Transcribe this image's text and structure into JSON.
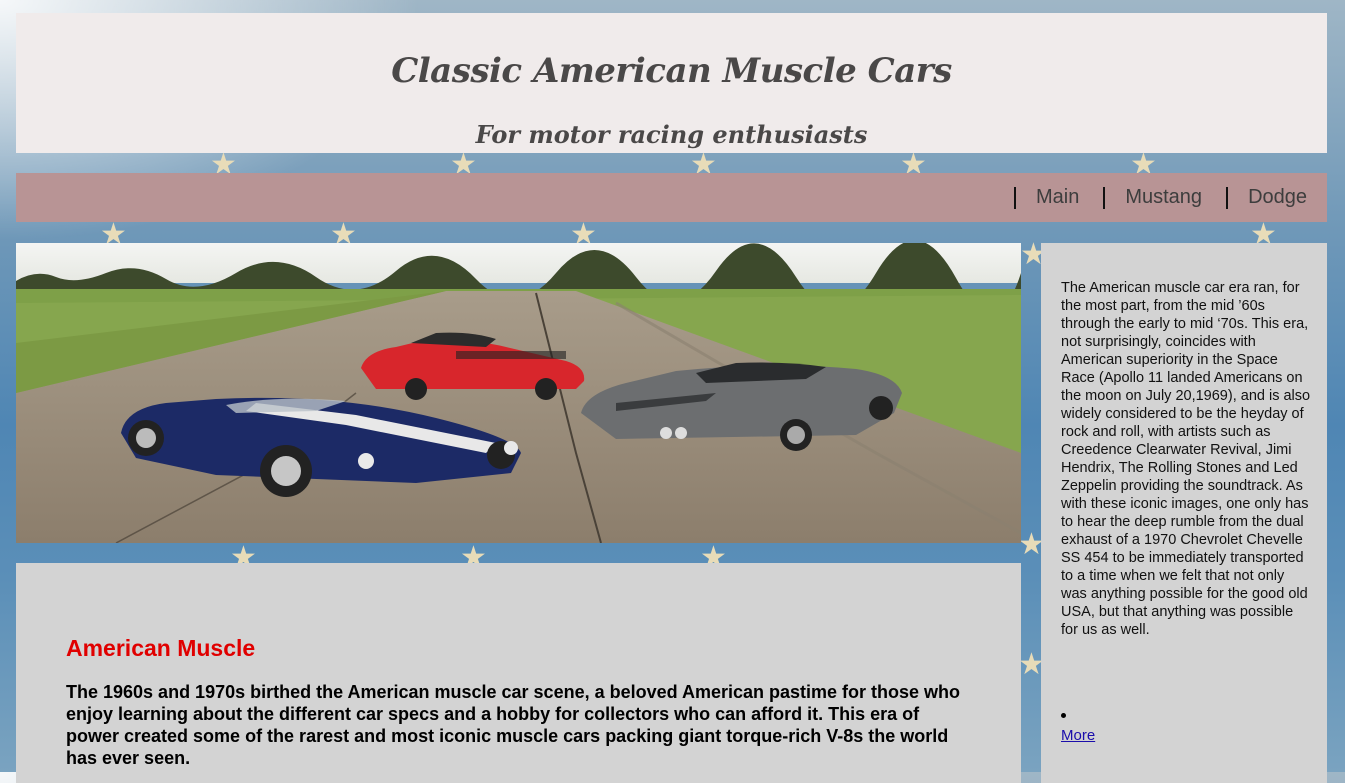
{
  "header": {
    "title": "Classic American Muscle Cars",
    "subtitle": "For motor racing enthusiasts"
  },
  "nav": {
    "items": [
      {
        "label": "Main"
      },
      {
        "label": "Mustang"
      },
      {
        "label": "Dodge"
      }
    ]
  },
  "hero": {
    "image": "three-classic-muscle-cars-on-runway"
  },
  "article": {
    "heading": "American Muscle",
    "body": "The 1960s and 1970s birthed the American muscle car scene, a beloved American pastime for those who enjoy learning about the different car specs and a hobby for collectors who can afford it. This era of power created some of the rarest and most iconic muscle cars packing giant torque-rich V-8s the world has ever seen."
  },
  "sidebar": {
    "text": "The American muscle car era ran, for the most part, from the mid ’60s through the early to mid ‘70s. This era, not surprisingly, coincides with American superiority in the Space Race (Apollo 11 landed Americans on the moon on July 20,1969), and is also widely considered to be the heyday of rock and roll, with artists such as Creedence Clearwater Revival, Jimi Hendrix, The Rolling Stones and Led Zeppelin providing the soundtrack. As with these iconic images, one only has to hear the deep rumble from the dual exhaust of a 1970 Chevrolet Chevelle SS 454 to be immediately transported to a time when we felt that not only was anything possible for the good old USA, but that anything was possible for us as well.",
    "link_label": "More"
  },
  "colors": {
    "header_bg": "#f0ebeb",
    "nav_bg": "#b89495",
    "panel_bg": "#d3d3d3",
    "heading_red": "#e00000",
    "link_blue": "#1a0dab"
  }
}
